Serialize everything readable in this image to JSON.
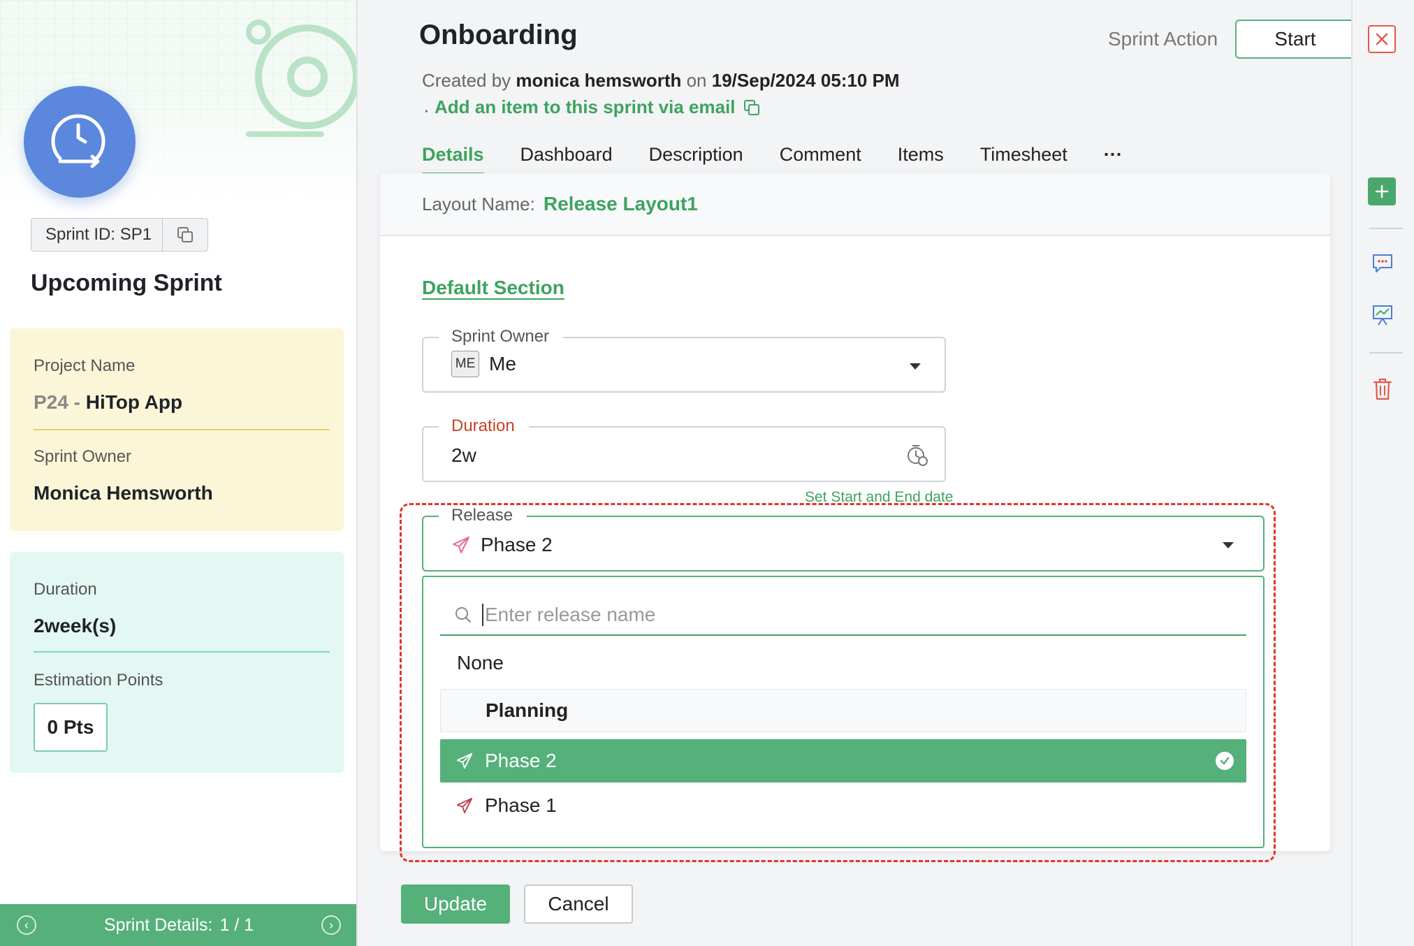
{
  "left": {
    "sprint_id": "Sprint ID: SP1",
    "status": "Upcoming Sprint",
    "project_label": "Project Name",
    "project_prefix": "P24 -",
    "project_name": "HiTop App",
    "owner_label": "Sprint Owner",
    "owner_name": "Monica Hemsworth",
    "duration_label": "Duration",
    "duration_value": "2week(s)",
    "estimation_label": "Estimation Points",
    "estimation_value": "0 Pts",
    "footer_label": "Sprint Details:",
    "footer_count": "1 / 1"
  },
  "header": {
    "title": "Onboarding",
    "sprint_action_label": "Sprint Action",
    "start_label": "Start",
    "created_prefix": "Created by",
    "created_by": "monica hemsworth",
    "created_on_word": "on",
    "created_date": "19/Sep/2024 05:10 PM",
    "email_link": "Add an item to this sprint via email"
  },
  "tabs": [
    {
      "label": "Details",
      "active": true
    },
    {
      "label": "Dashboard"
    },
    {
      "label": "Description"
    },
    {
      "label": "Comment"
    },
    {
      "label": "Items"
    },
    {
      "label": "Timesheet"
    },
    {
      "label": "···"
    }
  ],
  "form": {
    "layout_label": "Layout Name:",
    "layout_name": "Release Layout1",
    "section_title": "Default Section",
    "owner_legend": "Sprint Owner",
    "owner_badge": "ME",
    "owner_value": "Me",
    "duration_legend": "Duration",
    "duration_value": "2w",
    "duration_hint": "Set Start and End date",
    "release_legend": "Release",
    "release_value": "Phase 2",
    "search_placeholder": "Enter release name",
    "options": {
      "none": "None",
      "group": "Planning",
      "selected": "Phase 2",
      "other": "Phase 1"
    },
    "update_label": "Update",
    "cancel_label": "Cancel"
  },
  "colors": {
    "accent": "#55b07a",
    "accent_text": "#3ea35f",
    "required": "#c94224",
    "highlight": "#e3332a",
    "avatar": "#5b87dc"
  }
}
